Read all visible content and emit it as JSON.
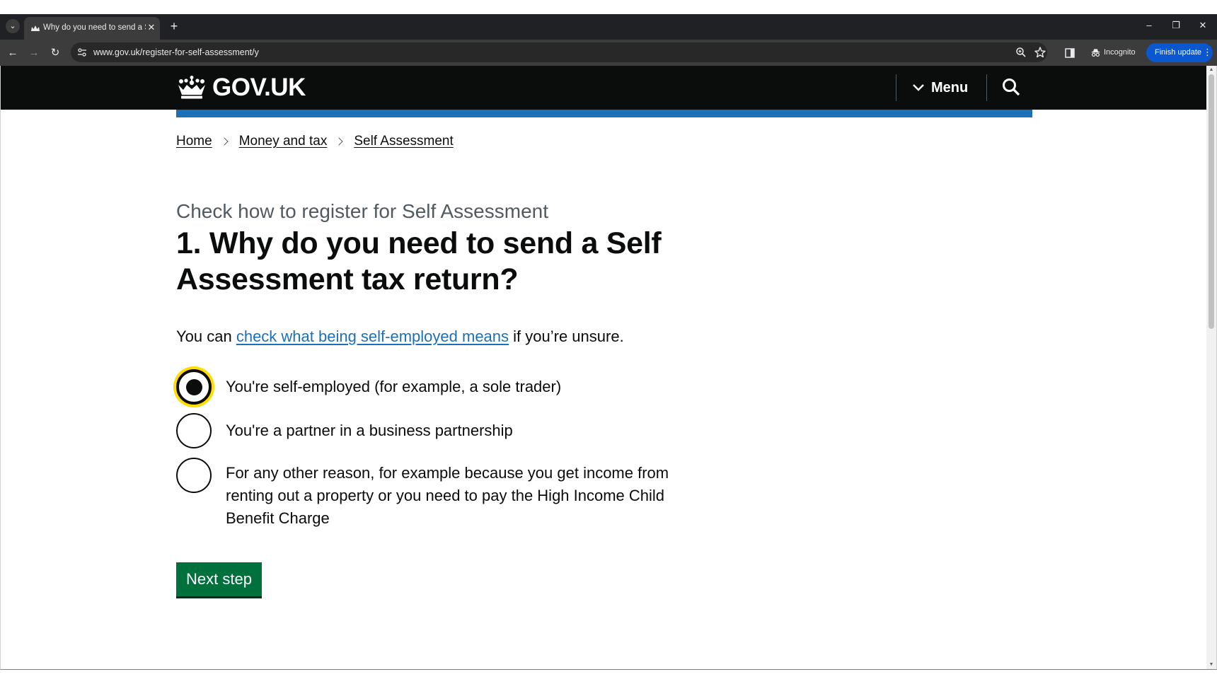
{
  "browser": {
    "tab_title": "Why do you need to send a Self",
    "tab_close": "✕",
    "tab_list_glyph": "⌄",
    "new_tab_glyph": "+",
    "url": "www.gov.uk/register-for-self-assessment/y",
    "incognito_label": "Incognito",
    "finish_update_label": "Finish update",
    "window_controls": {
      "minimize": "–",
      "restore": "❐",
      "close": "✕"
    },
    "nav": {
      "back": "←",
      "forward": "→",
      "reload": "↻"
    }
  },
  "header": {
    "logo_text": "GOV.UK",
    "menu_label": "Menu"
  },
  "breadcrumbs": {
    "items": [
      {
        "label": "Home"
      },
      {
        "label": "Money and tax"
      },
      {
        "label": "Self Assessment"
      }
    ]
  },
  "main": {
    "caption": "Check how to register for Self Assessment",
    "heading": "1. Why do you need to send a Self Assessment tax return?",
    "intro_prefix": "You can ",
    "intro_link": "check what being self-employed means",
    "intro_suffix": " if you’re unsure.",
    "options": [
      {
        "label": "You're self-employed (for example, a sole trader)",
        "selected": true
      },
      {
        "label": "You're a partner in a business partnership",
        "selected": false
      },
      {
        "label": "For any other reason, for example because you get income from renting out a property or you need to pay the High Income Child Benefit Charge",
        "selected": false
      }
    ],
    "next_button": "Next step"
  },
  "colors": {
    "gov_black": "#0b0c0c",
    "gov_blue": "#1d70b8",
    "button_green": "#00703c",
    "focus_yellow": "#ffdd00",
    "secondary_text": "#505a5f"
  },
  "icons": {
    "crown": "crown-icon",
    "menu_chevron": "chevron-down-icon",
    "search": "search-icon",
    "zoom": "zoom-icon",
    "bookmark": "star-icon",
    "side_panel": "side-panel-icon",
    "incognito": "incognito-icon"
  }
}
